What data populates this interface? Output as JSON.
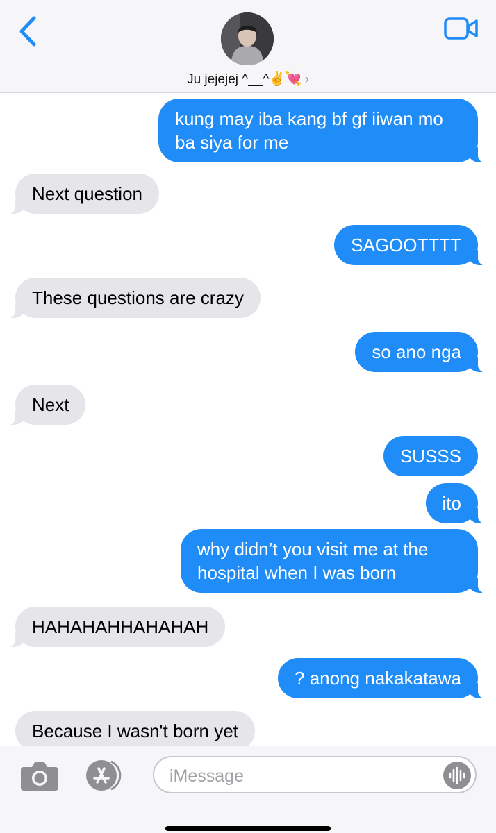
{
  "header": {
    "contact_name": "Ju jejejej ^__^✌️💘",
    "chevron": "›",
    "icons": {
      "back": "chevron-left-icon",
      "video": "video-camera-icon"
    },
    "accent_color": "#1f8cf7"
  },
  "messages": [
    {
      "direction": "outgoing",
      "text": "kung may iba kang bf gf iiwan mo ba siya for me"
    },
    {
      "direction": "incoming",
      "text": "Next question"
    },
    {
      "direction": "outgoing",
      "text": "SAGOOTTTT"
    },
    {
      "direction": "incoming",
      "text": "These questions are crazy"
    },
    {
      "direction": "outgoing",
      "text": "so ano nga"
    },
    {
      "direction": "incoming",
      "text": "Next"
    },
    {
      "direction": "outgoing",
      "text": "SUSSS"
    },
    {
      "direction": "outgoing",
      "text": "ito"
    },
    {
      "direction": "outgoing",
      "text": "why didn’t you visit me at the hospital when I was born"
    },
    {
      "direction": "incoming",
      "text": "HAHAHAHHAHAHAH"
    },
    {
      "direction": "outgoing",
      "text": "? anong nakakatawa"
    },
    {
      "direction": "incoming",
      "text": "Because I wasn't born yet"
    }
  ],
  "composer": {
    "placeholder": "iMessage",
    "value": "",
    "icons": {
      "camera": "camera-icon",
      "apps": "app-store-icon",
      "audio": "audio-waveform-icon"
    }
  },
  "colors": {
    "incoming_bubble": "#e5e5ea",
    "outgoing_bubble": "#1f8cf7"
  }
}
